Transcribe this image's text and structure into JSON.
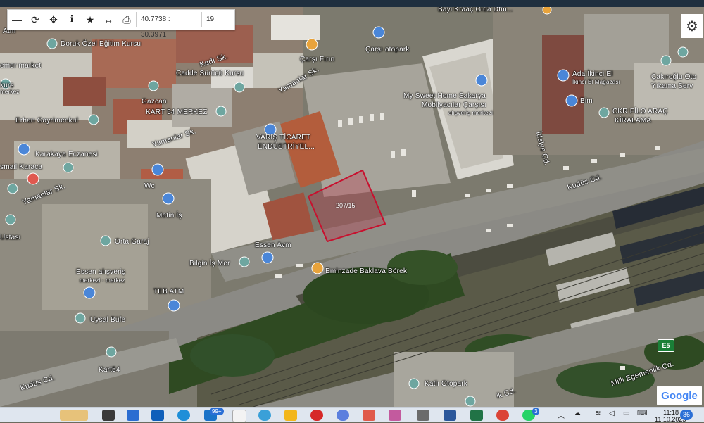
{
  "toolbar": {
    "coords": "40.7738 : 30.3971",
    "zoom": "19",
    "buttons": [
      "zoom-out",
      "refresh",
      "locate",
      "info",
      "bookmark",
      "measure",
      "print"
    ]
  },
  "map": {
    "labels": [
      {
        "id": "atm-top",
        "text": "Atm"
      },
      {
        "id": "doruk",
        "text": "Doruk Özel Eğitim Kursu"
      },
      {
        "id": "kadi",
        "text": "Kadı Sk."
      },
      {
        "id": "carsi-firin",
        "text": "Çarşı Fırın"
      },
      {
        "id": "bayi",
        "text": "Bayi Kraaç Gıda Dtm..."
      },
      {
        "id": "carsi-otopark",
        "text": "Çarşı otopark"
      },
      {
        "id": "emer",
        "text": "emer market"
      },
      {
        "id": "cadde",
        "text": "Cadde Sürücü Kursu"
      },
      {
        "id": "yamanlar1",
        "text": "Yamanlar Sk."
      },
      {
        "id": "kurs",
        "text": "kurs"
      },
      {
        "id": "merkez",
        "text": "merkez"
      },
      {
        "id": "gazcan",
        "text": "Gazcan"
      },
      {
        "id": "kart54",
        "text": "KART 54 MERKEZ"
      },
      {
        "id": "sweet",
        "text": "My Sweet Home Sakarya"
      },
      {
        "id": "mobilya",
        "text": "Mobilyacılar Çarşısı"
      },
      {
        "id": "alisveris",
        "text": "alışveriş merkezi"
      },
      {
        "id": "ada",
        "text": "Ada İkinci El"
      },
      {
        "id": "ikinci",
        "text": "İkinci El Mağazası"
      },
      {
        "id": "bim",
        "text": "Bim"
      },
      {
        "id": "cakiroglu",
        "text": "Çakıroğlu Oto"
      },
      {
        "id": "yikama",
        "text": "Yıkama Serv"
      },
      {
        "id": "ckr",
        "text": "CKR FİLO ARAÇ"
      },
      {
        "id": "kiralama",
        "text": "KİRALAMA"
      },
      {
        "id": "erhan",
        "text": "Erhan Gayrimenkul"
      },
      {
        "id": "yamanlar2",
        "text": "Yamanlar Sk."
      },
      {
        "id": "varis",
        "text": "VARIŞ TİCARET"
      },
      {
        "id": "endustri",
        "text": "ENDÜSTRİYEL..."
      },
      {
        "id": "karakaya",
        "text": "Karakaya Eczanesi"
      },
      {
        "id": "ismail",
        "text": "smail Karaca"
      },
      {
        "id": "itfaiye",
        "text": "İtfaiye Cd."
      },
      {
        "id": "kudus1",
        "text": "Kudüs Cd."
      },
      {
        "id": "yamanlar3",
        "text": "Yamanlar Sk."
      },
      {
        "id": "wc",
        "text": "Wc"
      },
      {
        "id": "metin",
        "text": "Metin İş"
      },
      {
        "id": "ustasi",
        "text": "Ustası"
      },
      {
        "id": "orta",
        "text": "Orta Garaj"
      },
      {
        "id": "essen",
        "text": "Essen Avm"
      },
      {
        "id": "bilgin",
        "text": "Bilgin İş Mer"
      },
      {
        "id": "eminzade",
        "text": "Eminzade Baklava Börek"
      },
      {
        "id": "essen-alisveris",
        "text": "Essen alışveriş"
      },
      {
        "id": "merkez2",
        "text": "merkezi · merkez"
      },
      {
        "id": "teb",
        "text": "TEB ATM"
      },
      {
        "id": "uysal",
        "text": "Uysal Büfe"
      },
      {
        "id": "kart54b",
        "text": "Kart54"
      },
      {
        "id": "kudus2",
        "text": "Kudüs Cd."
      },
      {
        "id": "katli",
        "text": "Katlı Otopark"
      },
      {
        "id": "ik-cd",
        "text": "ik Cd."
      },
      {
        "id": "milli",
        "text": "Milli Egemenlik Cd."
      }
    ],
    "parcel_label": "207/15",
    "parcel_color": "#c8102e",
    "road_badge": "E5",
    "attribution": "Google"
  },
  "taskbar": {
    "badge_edge": "99+",
    "badge_whatsapp": "3",
    "time": "11:18",
    "date": "11.10.2023",
    "notifications": "36"
  }
}
